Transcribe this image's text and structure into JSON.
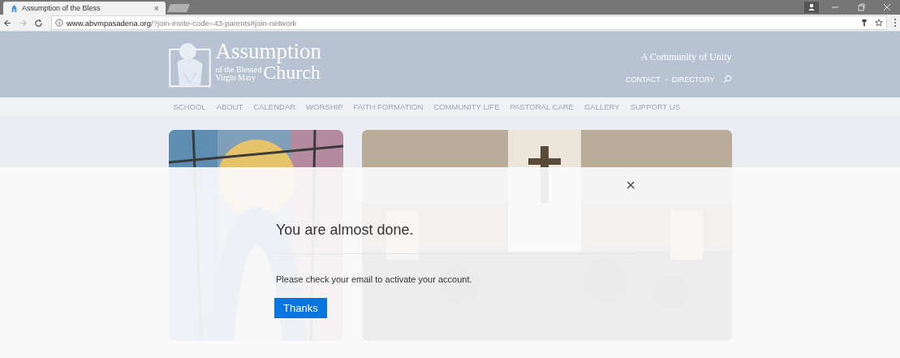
{
  "browser": {
    "tab_title": "Assumption of the Bless",
    "tab_close": "×",
    "url_host": "www.abvmpasadena.org",
    "url_path": "/?join-invite-code=43-parents#join-network"
  },
  "site": {
    "logo_title": "Assumption",
    "logo_small": "of the Blessed",
    "logo_line": "Virgin Mary",
    "logo_word": "Church",
    "tagline": "A Community of Unity",
    "utility_links": [
      "CONTACT",
      "DIRECTORY"
    ],
    "nav": [
      "SCHOOL",
      "ABOUT",
      "CALENDAR",
      "WORSHIP",
      "FAITH FORMATION",
      "COMMUNITY LIFE",
      "PASTORAL CARE",
      "GALLERY",
      "SUPPORT US"
    ]
  },
  "modal": {
    "close": "×",
    "heading": "You are almost done.",
    "message": "Please check your email to activate your account.",
    "button": "Thanks"
  }
}
